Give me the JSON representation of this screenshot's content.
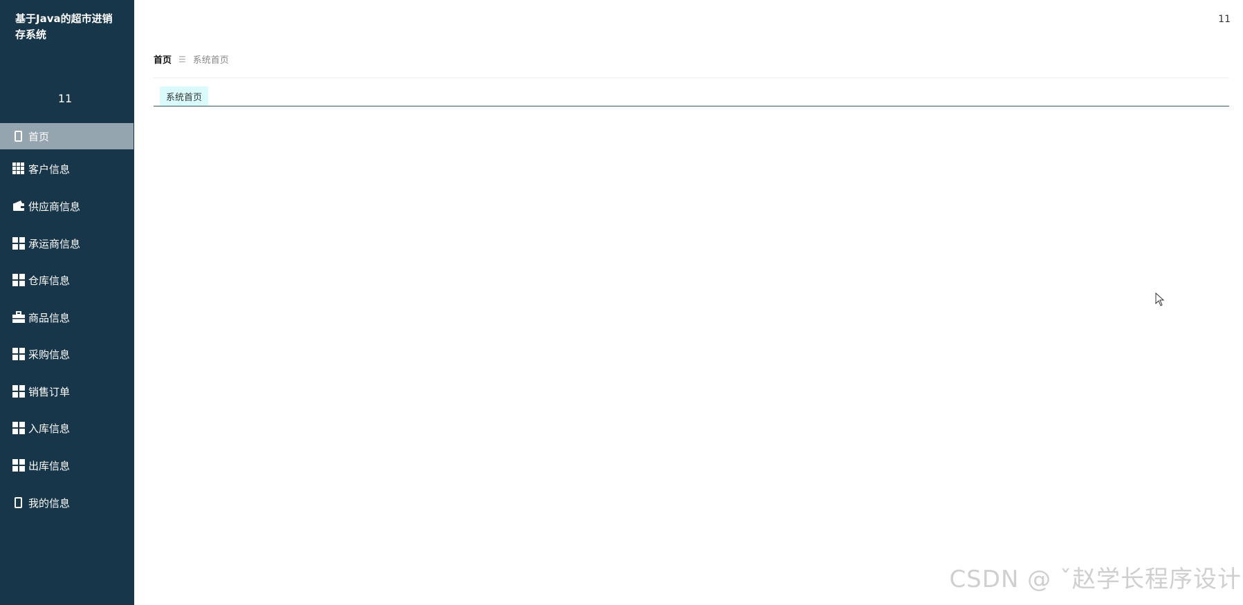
{
  "app": {
    "title": "基于Java的超市进销存系统",
    "user_name": "11"
  },
  "sidebar": {
    "items": [
      {
        "label": "首页",
        "icon": "phone-icon",
        "active": true
      },
      {
        "label": "客户信息",
        "icon": "grid-icon"
      },
      {
        "label": "供应商信息",
        "icon": "wallet-icon"
      },
      {
        "label": "承运商信息",
        "icon": "grid4-icon"
      },
      {
        "label": "仓库信息",
        "icon": "grid4-icon"
      },
      {
        "label": "商品信息",
        "icon": "briefcase-icon"
      },
      {
        "label": "采购信息",
        "icon": "grid4-icon"
      },
      {
        "label": "销售订单",
        "icon": "grid4-icon"
      },
      {
        "label": "入库信息",
        "icon": "grid4-icon"
      },
      {
        "label": "出库信息",
        "icon": "grid4-icon"
      },
      {
        "label": "我的信息",
        "icon": "phone-icon"
      }
    ]
  },
  "header": {
    "user": "11"
  },
  "breadcrumb": {
    "home": "首页",
    "separator": "☰",
    "current": "系统首页"
  },
  "tabs": [
    {
      "label": "系统首页"
    }
  ],
  "watermark": "CSDN @ ˇ赵学长程序设计",
  "colors": {
    "sidebar_bg": "#17364a",
    "active_item_bg": "#95a5b0",
    "tab_bg": "#d9fbfb"
  }
}
